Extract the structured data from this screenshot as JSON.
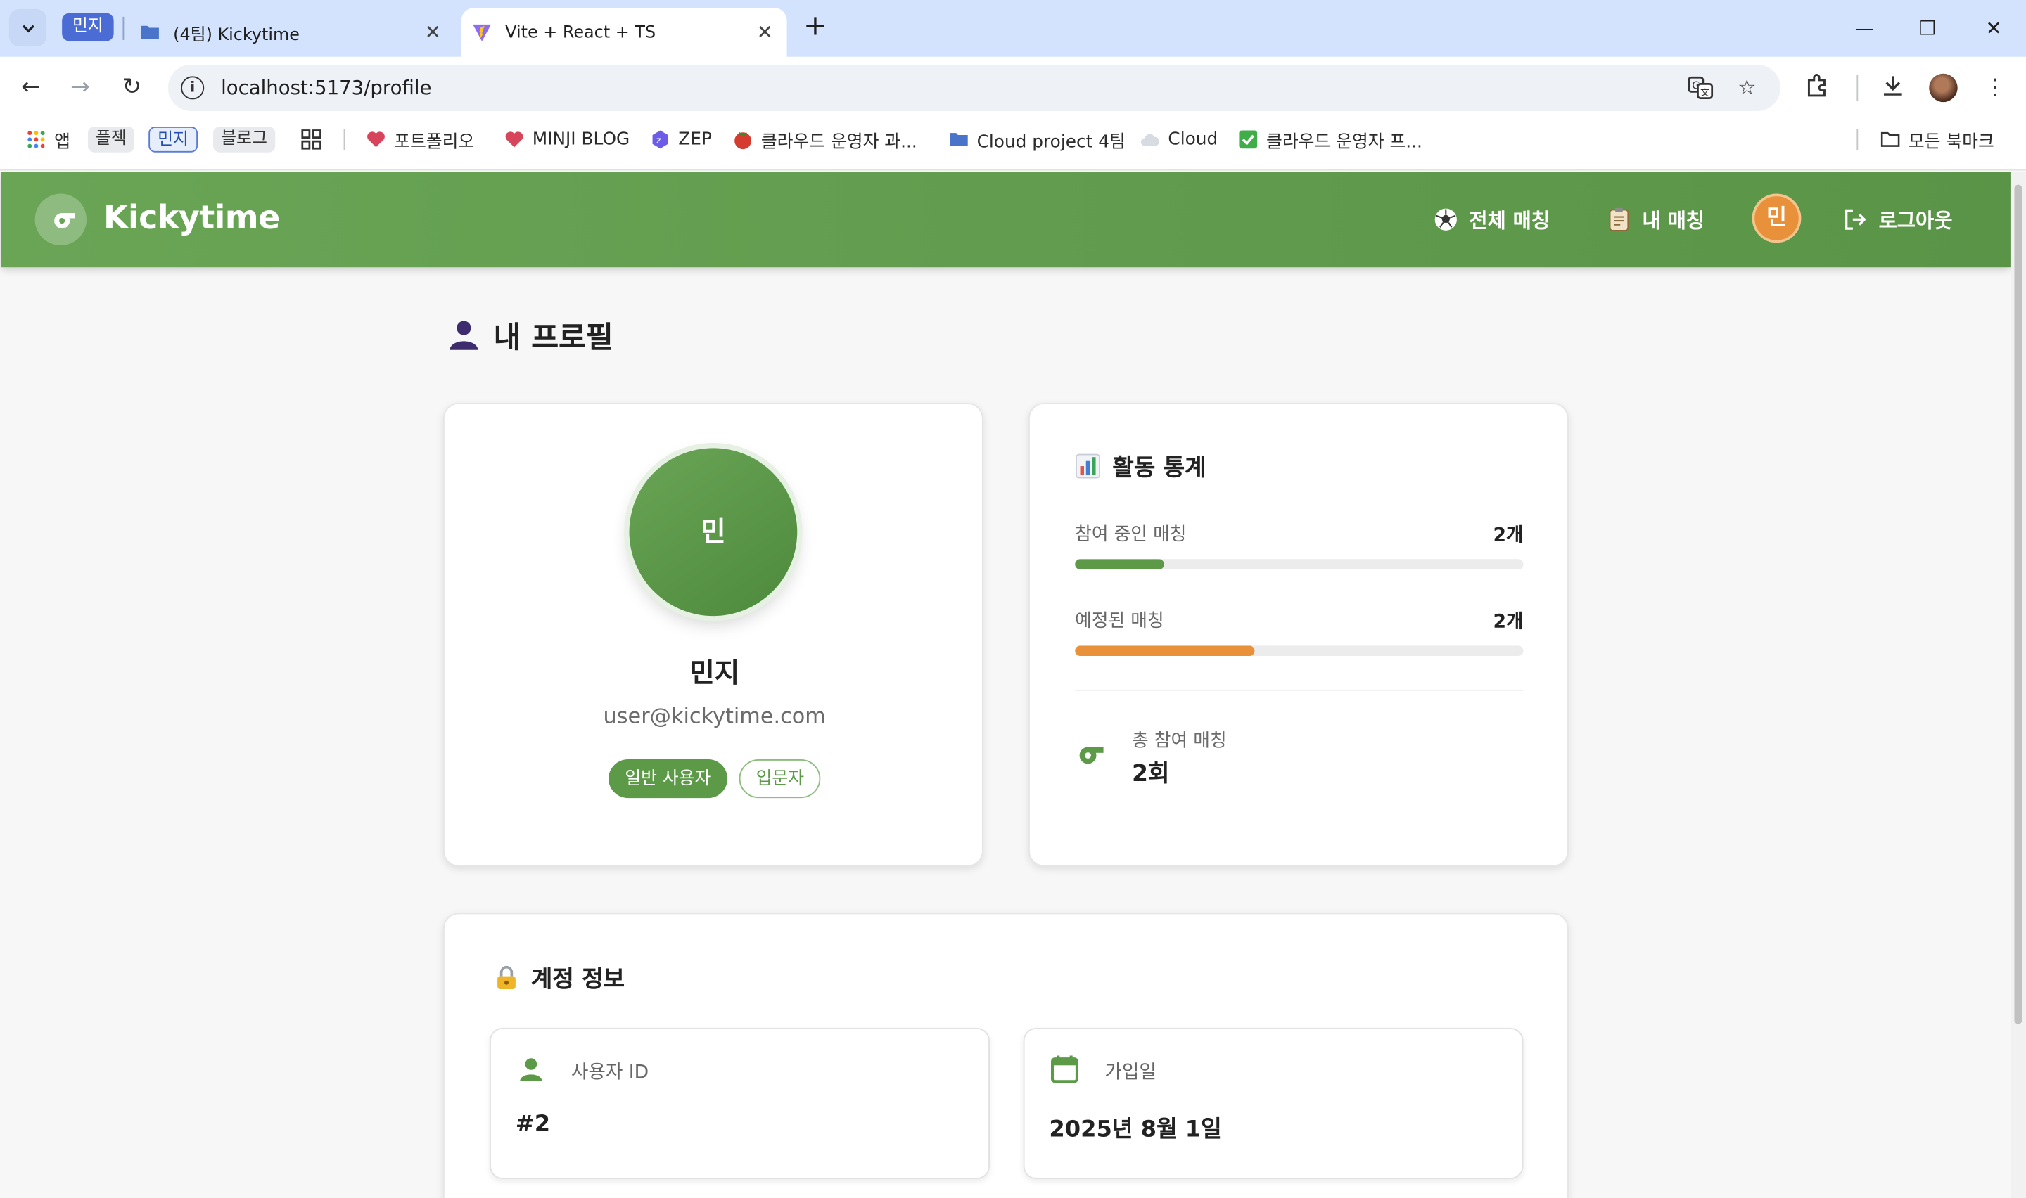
{
  "browser": {
    "tab_group_label": "민지",
    "tabs": [
      {
        "title": "(4팀) Kickytime",
        "active": false
      },
      {
        "title": "Vite + React + TS",
        "active": true
      }
    ],
    "new_tab_symbol": "+",
    "url": "localhost:5173/profile",
    "bookmarks": [
      {
        "label": "앱",
        "icon": "apps-grid-icon"
      },
      {
        "label": "플젝",
        "icon": "chip"
      },
      {
        "label": "민지",
        "icon": "chip-outlined"
      },
      {
        "label": "블로그",
        "icon": "chip"
      },
      {
        "label": "",
        "icon": "grid-icon"
      },
      {
        "label": "포트폴리오",
        "icon": "heart-icon"
      },
      {
        "label": "MINJI BLOG",
        "icon": "heart-icon"
      },
      {
        "label": "ZEP",
        "icon": "zep-icon"
      },
      {
        "label": "클라우드 운영자 과...",
        "icon": "tomato-icon"
      },
      {
        "label": "Cloud project 4팀",
        "icon": "folder-icon"
      },
      {
        "label": "Cloud",
        "icon": "cloud-icon"
      },
      {
        "label": "클라우드 운영자 프...",
        "icon": "checkbox-icon"
      }
    ],
    "all_bookmarks_label": "모든 북마크"
  },
  "app": {
    "brand": "Kickytime",
    "nav": {
      "all_matches": "전체 매칭",
      "my_matches": "내 매칭",
      "avatar_initial": "민",
      "logout": "로그아웃"
    }
  },
  "profile": {
    "page_title": "내 프로필",
    "avatar_initial": "민",
    "name": "민지",
    "email": "user@kickytime.com",
    "role_badge": "일반 사용자",
    "level_badge": "입문자"
  },
  "stats": {
    "heading": "활동 통계",
    "rows": [
      {
        "label": "참여 중인 매칭",
        "value": "2개",
        "progress": 0.2,
        "color": "#5c9a48"
      },
      {
        "label": "예정된 매칭",
        "value": "2개",
        "progress": 0.4,
        "color": "#e8913a"
      }
    ],
    "total_label": "총 참여 매칭",
    "total_value": "2회"
  },
  "account": {
    "heading": "계정 정보",
    "user_id_label": "사용자 ID",
    "user_id_value": "#2",
    "joined_label": "가입일",
    "joined_value": "2025년 8월 1일"
  },
  "colors": {
    "brand_green": "#5c9a48",
    "accent_orange": "#e8913a"
  }
}
